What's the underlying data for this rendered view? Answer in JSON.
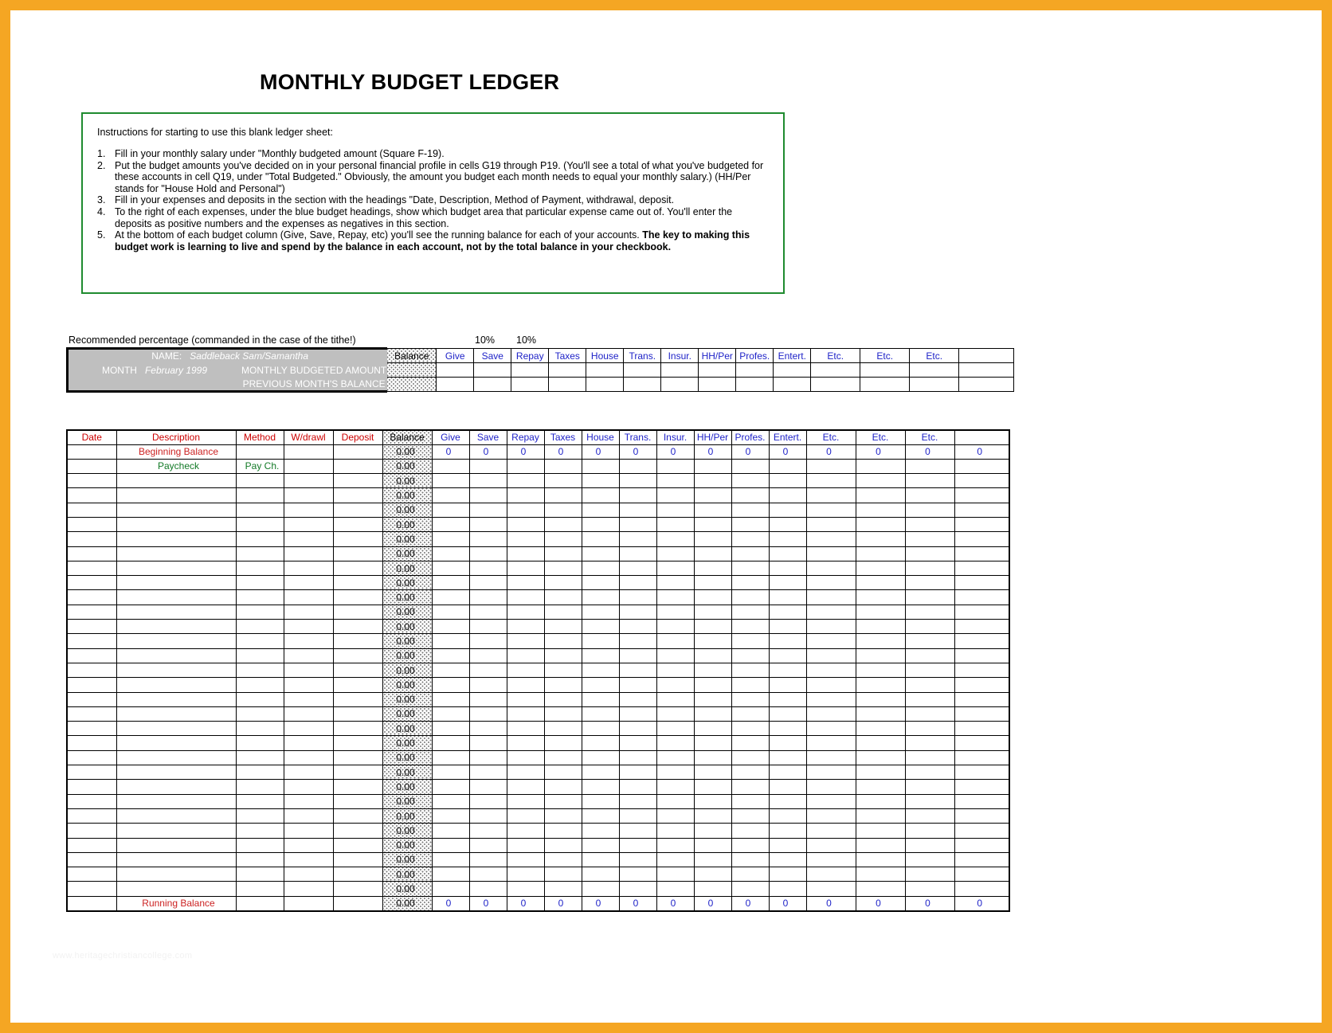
{
  "document": {
    "title": "MONTHLY BUDGET LEDGER",
    "watermark": "www.heritagechristiancollege.com"
  },
  "instructions": {
    "intro": "Instructions for starting to use this blank ledger sheet:",
    "items": [
      {
        "num": "1.",
        "text": "Fill in your monthly salary under \"Monthly budgeted amount (Square F-19)."
      },
      {
        "num": "2.",
        "text": "Put the budget amounts you've decided on in your personal financial profile in cells G19 through P19.  (You'll see a total of what you've budgeted for these accounts in cell Q19, under \"Total Budgeted.\"  Obviously, the amount you budget each month needs to equal your monthly salary.)      (HH/Per stands for \"House Hold and Personal\")"
      },
      {
        "num": "3.",
        "text": "Fill in your expenses and deposits in the section with the headings \"Date, Description, Method of Payment, withdrawal, deposit."
      },
      {
        "num": "4.",
        "text": "To the right of each expenses, under the blue budget headings, show which budget area that particular expense came out of.  You'll enter the deposits as positive numbers and the expenses as negatives in this section."
      },
      {
        "num": "5.",
        "text": "At the bottom of each budget column (Give, Save, Repay, etc) you'll see the running balance for each of your accounts.  ",
        "bold_tail": "The key to making this budget work is learning to live and spend by the balance in each account, not by the total balance in your checkbook."
      }
    ]
  },
  "recommended_percentage": {
    "label": "Recommended percentage (commanded in the case of the tithe!)",
    "values": [
      "10%",
      "10%"
    ]
  },
  "header": {
    "name_label": "NAME:",
    "name_value": "Saddleback Sam/Samantha",
    "month_label": "MONTH",
    "month_value": "February 1999",
    "budgeted_label": "MONTHLY BUDGETED AMOUNT",
    "previous_balance_label": "PREVIOUS MONTH'S BALANCE",
    "balance_header": "Balance"
  },
  "budget_columns": [
    "Give",
    "Save",
    "Repay",
    "Taxes",
    "House",
    "Trans.",
    "Insur.",
    "HH/Per",
    "Profes.",
    "Entert.",
    "Etc.",
    "Etc.",
    "Etc.",
    ""
  ],
  "ledger": {
    "columns": [
      "Date",
      "Description",
      "Method",
      "W/drawl",
      "Deposit"
    ],
    "balance_column": "Balance",
    "rows": [
      {
        "date": "",
        "description": "Beginning Balance",
        "desc_style": "red",
        "method": "",
        "wdrawl": "",
        "deposit": "",
        "balance": "0.00",
        "budget": [
          "0",
          "0",
          "0",
          "0",
          "0",
          "0",
          "0",
          "0",
          "0",
          "0",
          "0",
          "0",
          "0",
          "0"
        ]
      },
      {
        "date": "",
        "description": "Paycheck",
        "desc_style": "green",
        "method": "Pay Ch.",
        "wdrawl": "",
        "deposit": "",
        "balance": "0.00",
        "budget": [
          "",
          "",
          "",
          "",
          "",
          "",
          "",
          "",
          "",
          "",
          "",
          "",
          "",
          ""
        ]
      },
      {
        "date": "",
        "description": "",
        "method": "",
        "wdrawl": "",
        "deposit": "",
        "balance": "0.00",
        "budget": [
          "",
          "",
          "",
          "",
          "",
          "",
          "",
          "",
          "",
          "",
          "",
          "",
          "",
          ""
        ]
      },
      {
        "date": "",
        "description": "",
        "method": "",
        "wdrawl": "",
        "deposit": "",
        "balance": "0.00",
        "budget": [
          "",
          "",
          "",
          "",
          "",
          "",
          "",
          "",
          "",
          "",
          "",
          "",
          "",
          ""
        ]
      },
      {
        "date": "",
        "description": "",
        "method": "",
        "wdrawl": "",
        "deposit": "",
        "balance": "0.00",
        "budget": [
          "",
          "",
          "",
          "",
          "",
          "",
          "",
          "",
          "",
          "",
          "",
          "",
          "",
          ""
        ]
      },
      {
        "date": "",
        "description": "",
        "method": "",
        "wdrawl": "",
        "deposit": "",
        "balance": "0.00",
        "budget": [
          "",
          "",
          "",
          "",
          "",
          "",
          "",
          "",
          "",
          "",
          "",
          "",
          "",
          ""
        ]
      },
      {
        "date": "",
        "description": "",
        "method": "",
        "wdrawl": "",
        "deposit": "",
        "balance": "0.00",
        "budget": [
          "",
          "",
          "",
          "",
          "",
          "",
          "",
          "",
          "",
          "",
          "",
          "",
          "",
          ""
        ]
      },
      {
        "date": "",
        "description": "",
        "method": "",
        "wdrawl": "",
        "deposit": "",
        "balance": "0.00",
        "budget": [
          "",
          "",
          "",
          "",
          "",
          "",
          "",
          "",
          "",
          "",
          "",
          "",
          "",
          ""
        ]
      },
      {
        "date": "",
        "description": "",
        "method": "",
        "wdrawl": "",
        "deposit": "",
        "balance": "0.00",
        "budget": [
          "",
          "",
          "",
          "",
          "",
          "",
          "",
          "",
          "",
          "",
          "",
          "",
          "",
          ""
        ]
      },
      {
        "date": "",
        "description": "",
        "method": "",
        "wdrawl": "",
        "deposit": "",
        "balance": "0.00",
        "budget": [
          "",
          "",
          "",
          "",
          "",
          "",
          "",
          "",
          "",
          "",
          "",
          "",
          "",
          ""
        ]
      },
      {
        "date": "",
        "description": "",
        "method": "",
        "wdrawl": "",
        "deposit": "",
        "balance": "0.00",
        "budget": [
          "",
          "",
          "",
          "",
          "",
          "",
          "",
          "",
          "",
          "",
          "",
          "",
          "",
          ""
        ]
      },
      {
        "date": "",
        "description": "",
        "method": "",
        "wdrawl": "",
        "deposit": "",
        "balance": "0.00",
        "budget": [
          "",
          "",
          "",
          "",
          "",
          "",
          "",
          "",
          "",
          "",
          "",
          "",
          "",
          ""
        ]
      },
      {
        "date": "",
        "description": "",
        "method": "",
        "wdrawl": "",
        "deposit": "",
        "balance": "0.00",
        "budget": [
          "",
          "",
          "",
          "",
          "",
          "",
          "",
          "",
          "",
          "",
          "",
          "",
          "",
          ""
        ]
      },
      {
        "date": "",
        "description": "",
        "method": "",
        "wdrawl": "",
        "deposit": "",
        "balance": "0.00",
        "budget": [
          "",
          "",
          "",
          "",
          "",
          "",
          "",
          "",
          "",
          "",
          "",
          "",
          "",
          ""
        ]
      },
      {
        "date": "",
        "description": "",
        "method": "",
        "wdrawl": "",
        "deposit": "",
        "balance": "0.00",
        "budget": [
          "",
          "",
          "",
          "",
          "",
          "",
          "",
          "",
          "",
          "",
          "",
          "",
          "",
          ""
        ]
      },
      {
        "date": "",
        "description": "",
        "method": "",
        "wdrawl": "",
        "deposit": "",
        "balance": "0.00",
        "budget": [
          "",
          "",
          "",
          "",
          "",
          "",
          "",
          "",
          "",
          "",
          "",
          "",
          "",
          ""
        ]
      },
      {
        "date": "",
        "description": "",
        "method": "",
        "wdrawl": "",
        "deposit": "",
        "balance": "0.00",
        "budget": [
          "",
          "",
          "",
          "",
          "",
          "",
          "",
          "",
          "",
          "",
          "",
          "",
          "",
          ""
        ]
      },
      {
        "date": "",
        "description": "",
        "method": "",
        "wdrawl": "",
        "deposit": "",
        "balance": "0.00",
        "budget": [
          "",
          "",
          "",
          "",
          "",
          "",
          "",
          "",
          "",
          "",
          "",
          "",
          "",
          ""
        ]
      },
      {
        "date": "",
        "description": "",
        "method": "",
        "wdrawl": "",
        "deposit": "",
        "balance": "0.00",
        "budget": [
          "",
          "",
          "",
          "",
          "",
          "",
          "",
          "",
          "",
          "",
          "",
          "",
          "",
          ""
        ]
      },
      {
        "date": "",
        "description": "",
        "method": "",
        "wdrawl": "",
        "deposit": "",
        "balance": "0.00",
        "budget": [
          "",
          "",
          "",
          "",
          "",
          "",
          "",
          "",
          "",
          "",
          "",
          "",
          "",
          ""
        ]
      },
      {
        "date": "",
        "description": "",
        "method": "",
        "wdrawl": "",
        "deposit": "",
        "balance": "0.00",
        "budget": [
          "",
          "",
          "",
          "",
          "",
          "",
          "",
          "",
          "",
          "",
          "",
          "",
          "",
          ""
        ]
      },
      {
        "date": "",
        "description": "",
        "method": "",
        "wdrawl": "",
        "deposit": "",
        "balance": "0.00",
        "budget": [
          "",
          "",
          "",
          "",
          "",
          "",
          "",
          "",
          "",
          "",
          "",
          "",
          "",
          ""
        ]
      },
      {
        "date": "",
        "description": "",
        "method": "",
        "wdrawl": "",
        "deposit": "",
        "balance": "0.00",
        "budget": [
          "",
          "",
          "",
          "",
          "",
          "",
          "",
          "",
          "",
          "",
          "",
          "",
          "",
          ""
        ]
      },
      {
        "date": "",
        "description": "",
        "method": "",
        "wdrawl": "",
        "deposit": "",
        "balance": "0.00",
        "budget": [
          "",
          "",
          "",
          "",
          "",
          "",
          "",
          "",
          "",
          "",
          "",
          "",
          "",
          ""
        ]
      },
      {
        "date": "",
        "description": "",
        "method": "",
        "wdrawl": "",
        "deposit": "",
        "balance": "0.00",
        "budget": [
          "",
          "",
          "",
          "",
          "",
          "",
          "",
          "",
          "",
          "",
          "",
          "",
          "",
          ""
        ]
      },
      {
        "date": "",
        "description": "",
        "method": "",
        "wdrawl": "",
        "deposit": "",
        "balance": "0.00",
        "budget": [
          "",
          "",
          "",
          "",
          "",
          "",
          "",
          "",
          "",
          "",
          "",
          "",
          "",
          ""
        ]
      },
      {
        "date": "",
        "description": "",
        "method": "",
        "wdrawl": "",
        "deposit": "",
        "balance": "0.00",
        "budget": [
          "",
          "",
          "",
          "",
          "",
          "",
          "",
          "",
          "",
          "",
          "",
          "",
          "",
          ""
        ]
      },
      {
        "date": "",
        "description": "",
        "method": "",
        "wdrawl": "",
        "deposit": "",
        "balance": "0.00",
        "budget": [
          "",
          "",
          "",
          "",
          "",
          "",
          "",
          "",
          "",
          "",
          "",
          "",
          "",
          ""
        ]
      },
      {
        "date": "",
        "description": "",
        "method": "",
        "wdrawl": "",
        "deposit": "",
        "balance": "0.00",
        "budget": [
          "",
          "",
          "",
          "",
          "",
          "",
          "",
          "",
          "",
          "",
          "",
          "",
          "",
          ""
        ]
      },
      {
        "date": "",
        "description": "",
        "method": "",
        "wdrawl": "",
        "deposit": "",
        "balance": "0.00",
        "budget": [
          "",
          "",
          "",
          "",
          "",
          "",
          "",
          "",
          "",
          "",
          "",
          "",
          "",
          ""
        ]
      },
      {
        "date": "",
        "description": "",
        "method": "",
        "wdrawl": "",
        "deposit": "",
        "balance": "0.00",
        "budget": [
          "",
          "",
          "",
          "",
          "",
          "",
          "",
          "",
          "",
          "",
          "",
          "",
          "",
          ""
        ]
      }
    ],
    "footer_row": {
      "date": "",
      "description": "Running Balance",
      "desc_style": "red",
      "method": "",
      "wdrawl": "",
      "deposit": "",
      "balance": "0.00",
      "budget": [
        "0",
        "0",
        "0",
        "0",
        "0",
        "0",
        "0",
        "0",
        "0",
        "0",
        "0",
        "0",
        "0",
        "0"
      ]
    }
  }
}
